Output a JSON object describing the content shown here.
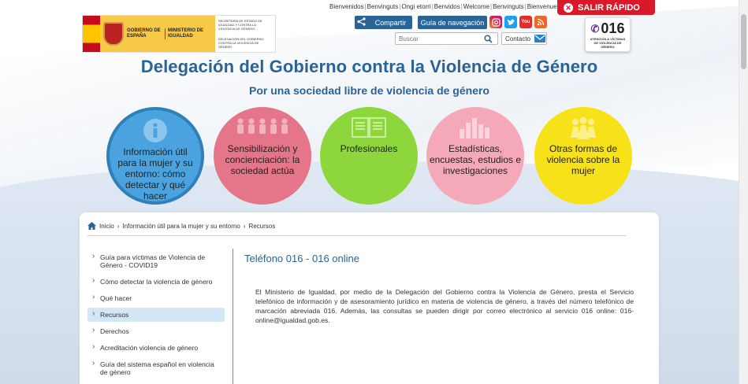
{
  "header": {
    "logo": {
      "gov_line": "GOBIERNO DE ESPAÑA",
      "ministry_line": "MINISTERIO DE IGUALDAD",
      "secretaria": "SECRETARÍA DE ESTADO DE IGUALDAD Y CONTRA LA VIOLENCIA DE GÉNERO",
      "delegacion": "DELEGACIÓN DEL GOBIERNO CONTRA LA VIOLENCIA DE GÉNERO"
    },
    "languages": [
      "Bienvenidos",
      "Benvinguts",
      "Ongi etorri",
      "Benvidos",
      "Welcome",
      "Benvinguts",
      "Bienvenue"
    ],
    "salir_label": "SALIR RÁPIDO",
    "share_label": "Compartir",
    "guia_label": "Guía de navegación",
    "social": [
      "instagram-icon",
      "twitter-icon",
      "youtube-icon",
      "rss-icon"
    ],
    "youtube_text": "You",
    "search_placeholder": "Buscar",
    "contacto_label": "Contacto",
    "badge": {
      "number": "016",
      "subtitle": "ATENCIÓN A VÍCTIMAS DE VIOLENCIA DE GÉNERO"
    }
  },
  "title": "Delegación del Gobierno contra la Violencia de Género",
  "subtitle": "Por una sociedad libre de violencia de género",
  "circles": [
    {
      "label": "Información útil para la mujer y su entorno: cómo detectar y qué hacer",
      "icon": "info-icon",
      "color": "#4aa3df"
    },
    {
      "label": "Sensibilización y concienciación: la sociedad actúa",
      "icon": "people-icon",
      "color": "#e57589"
    },
    {
      "label": "Profesionales",
      "icon": "book-icon",
      "color": "#8dd63b"
    },
    {
      "label": "Estadísticas, encuestas, estudios e investigaciones",
      "icon": "bar-chart-icon",
      "color": "#f5a9b8"
    },
    {
      "label": "Otras formas de violencia sobre la mujer",
      "icon": "women-group-icon",
      "color": "#f7e21a"
    }
  ],
  "breadcrumb": [
    "Inicio",
    "Información útil para la mujer y su entorno",
    "Recursos"
  ],
  "sidebar": {
    "items": [
      {
        "label": "Guía para víctimas de Violencia de Género - COVID19"
      },
      {
        "label": "Cómo detectar la violencia de género"
      },
      {
        "label": "Qué hacer"
      },
      {
        "label": "Recursos",
        "active": true
      },
      {
        "label": "Derechos"
      },
      {
        "label": "Acreditación violencia de género"
      },
      {
        "label": "Guía del sistema español en violencia de género"
      }
    ]
  },
  "content": {
    "title": "Teléfono 016 - 016 online",
    "text": "El Ministerio de Igualdad, por medio de la Delegación del Gobierno contra la Violencia de Género, presta el Servicio telefónico de información y de asesoramiento jurídico en materia de violencia de género, a través del número telefónico de marcación abreviada 016. Además, las consultas se pueden dirigir por correo electrónico al servicio 016 online: 016-online@igualdad.gob.es."
  },
  "colors": {
    "brand_blue": "#2a6496",
    "salir_red": "#d9182a",
    "active_menu": "#d3e6f5"
  }
}
